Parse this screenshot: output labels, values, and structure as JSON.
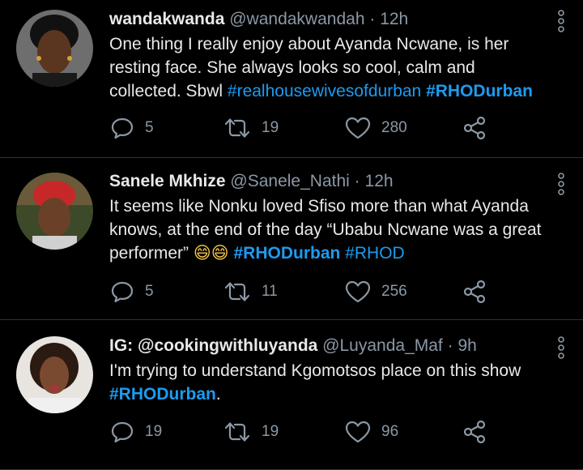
{
  "tweets": [
    {
      "name": "wandakwanda",
      "handle": "@wandakwandah",
      "time": "12h",
      "text_plain": "One thing I really enjoy about Ayanda Ncwane, is her resting face. She always looks so cool, calm and collected. Sbwl ",
      "hashtags": [
        "#realhousewivesofdurban",
        "#RHODurban"
      ],
      "replies": "5",
      "retweets": "19",
      "likes": "280"
    },
    {
      "name": "Sanele Mkhize",
      "handle": "@Sanele_Nathi",
      "time": "12h",
      "text_plain": "It seems like Nonku loved Sfiso more than what Ayanda knows, at the end of the day “Ubabu Ncwane was a great performer” ",
      "emoji": "😄😄",
      "hashtags": [
        "#RHODurban",
        "#RHOD"
      ],
      "replies": "5",
      "retweets": "11",
      "likes": "256"
    },
    {
      "name": "IG: @cookingwithluyanda",
      "handle": "@Luyanda_Maf",
      "time": "9h",
      "text_plain": "I'm trying to understand Kgomotsos place on this show ",
      "hashtags": [
        "#RHODurban"
      ],
      "text_after": ".",
      "replies": "19",
      "retweets": "19",
      "likes": "96"
    }
  ],
  "separator": "·",
  "icons": {
    "reply": "reply-icon",
    "retweet": "retweet-icon",
    "like": "heart-icon",
    "share": "share-icon",
    "more": "more-vertical-icon"
  },
  "colors": {
    "background": "#000000",
    "text": "#e7e9ea",
    "muted": "#8b98a5",
    "hashtag": "#1d9bf0",
    "divider": "#2f3336"
  }
}
